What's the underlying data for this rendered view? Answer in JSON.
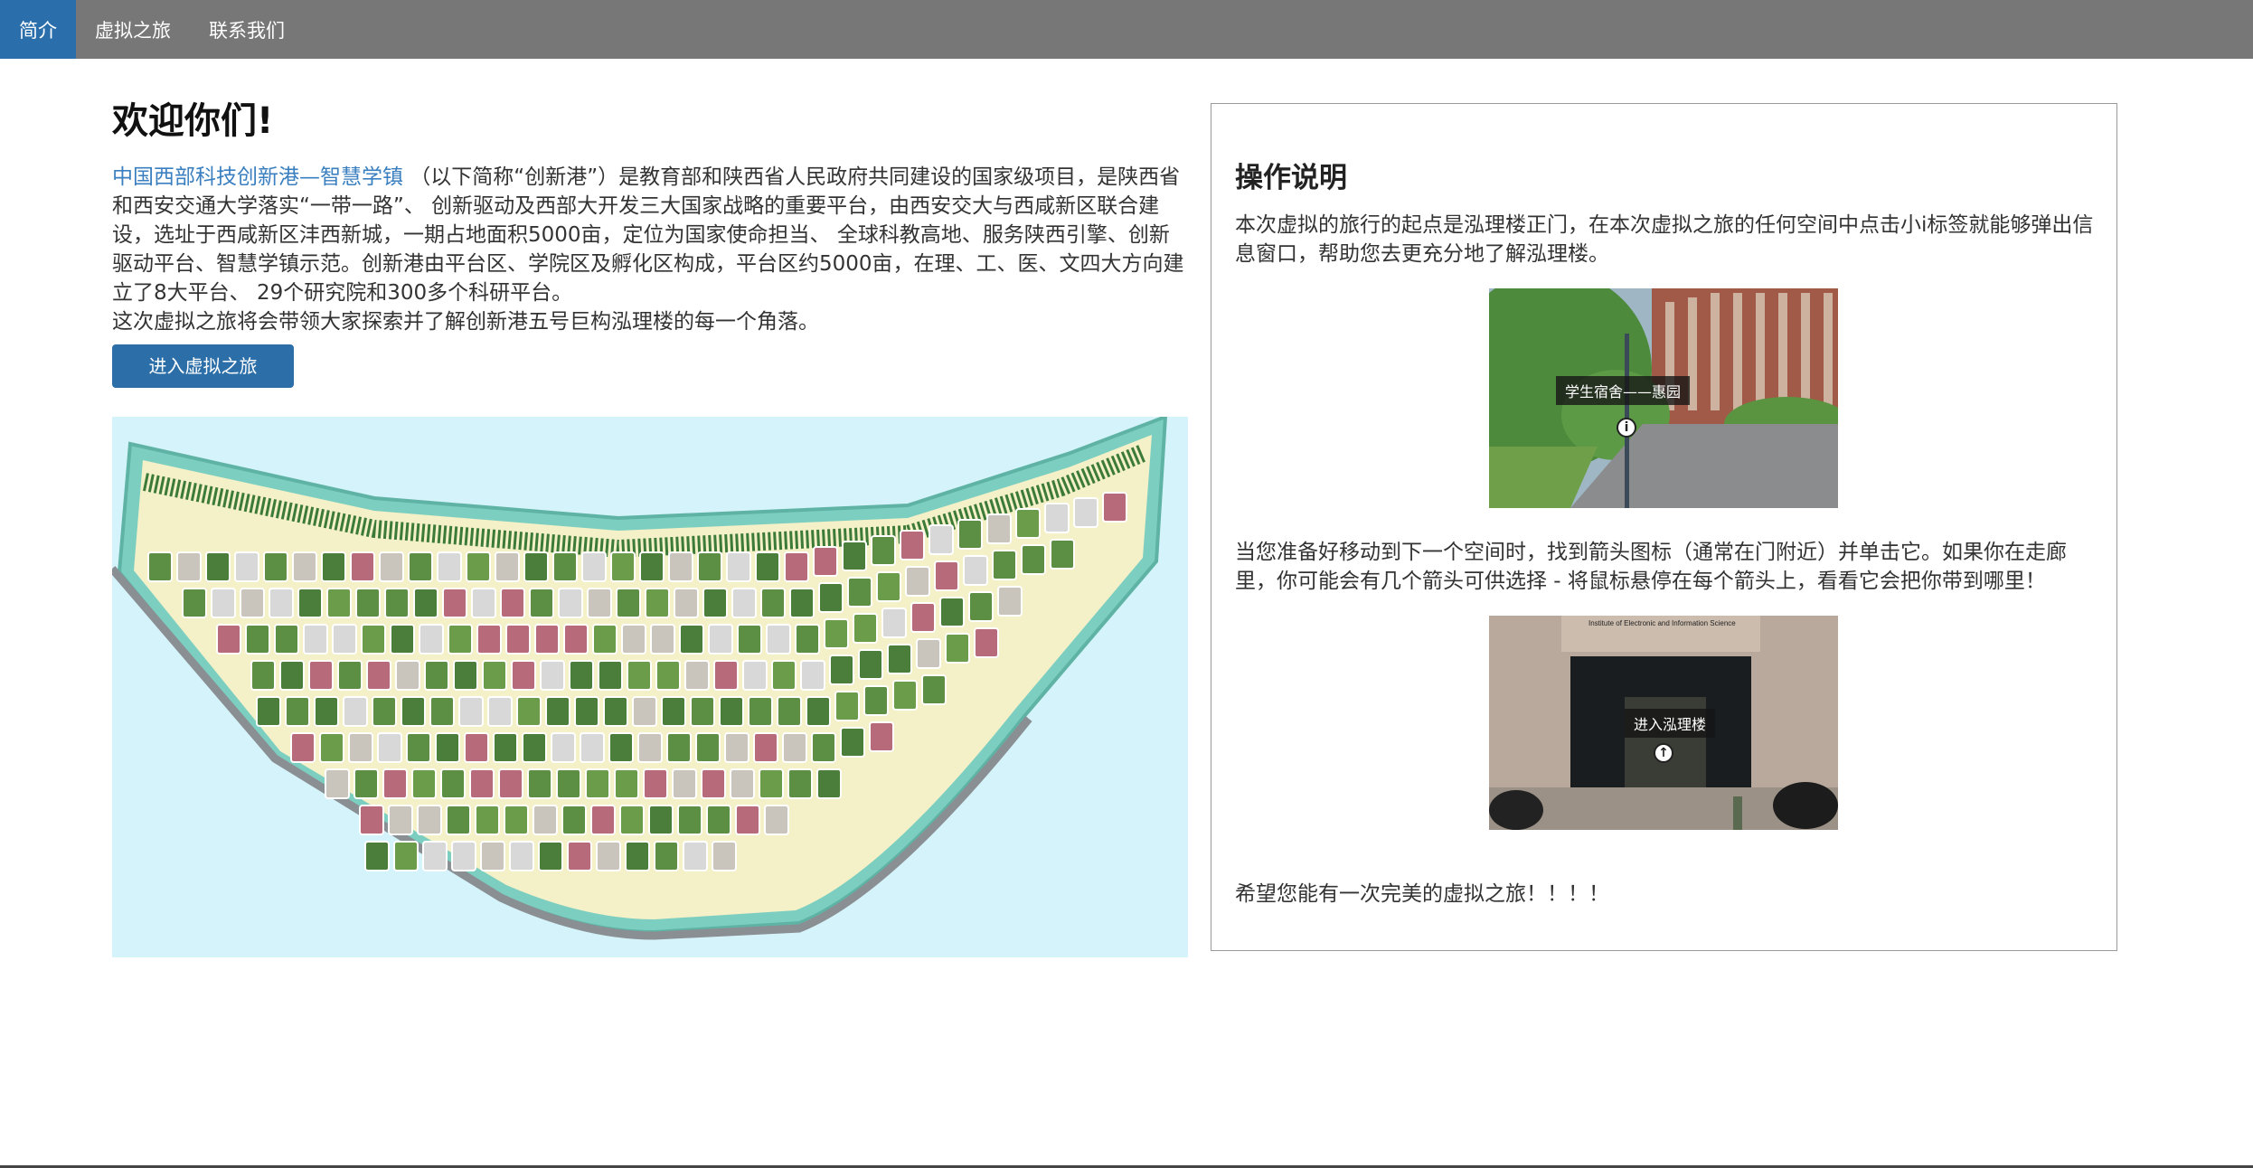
{
  "nav": {
    "items": [
      {
        "label": "简介",
        "active": true
      },
      {
        "label": "虚拟之旅",
        "active": false
      },
      {
        "label": "联系我们",
        "active": false
      }
    ]
  },
  "main": {
    "title": "欢迎你们!",
    "link_text": "中国西部科技创新港—智慧学镇",
    "intro_text": " （以下简称“创新港”）是教育部和陕西省人民政府共同建设的国家级项目，是陕西省和西安交通大学落实“一带一路”、 创新驱动及西部大开发三大国家战略的重要平台，由西安交大与西咸新区联合建设，选址于西咸新区沣西新城，一期占地面积5000亩，定位为国家使命担当、 全球科教高地、服务陕西引擎、创新驱动平台、智慧学镇示范。创新港由平台区、学院区及孵化区构成，平台区约5000亩，在理、工、医、文四大方向建立了8大平台、 29个研究院和300多个科研平台。",
    "intro_text2": "这次虚拟之旅将会带领大家探索并了解创新港五号巨构泓理楼的每一个角落。",
    "enter_button": "进入虚拟之旅"
  },
  "instructions": {
    "title": "操作说明",
    "para1": "本次虚拟的旅行的起点是泓理楼正门，在本次虚拟之旅的任何空间中点击小i标签就能够弹出信息窗口，帮助您去更充分地了解泓理楼。",
    "photo1_label": "学生宿舍——惠园",
    "photo1_icon": "info-icon",
    "para2": "当您准备好移动到下一个空间时，找到箭头图标（通常在门附近）并单击它。如果你在走廊里，你可能会有几个箭头可供选择 - 将鼠标悬停在每个箭头上，看看它会把你带到哪里！",
    "photo2_sign": "Institute of Electronic and Information Science",
    "photo2_label": "进入泓理楼",
    "photo2_icon": "arrow-up-icon",
    "closing": "希望您能有一次完美的虚拟之旅！！！！"
  },
  "colors": {
    "nav_bg": "#777777",
    "nav_active": "#2a6fac",
    "button": "#2b6ea8",
    "link": "#3a7fc0",
    "map_water": "#d4f3fa"
  }
}
